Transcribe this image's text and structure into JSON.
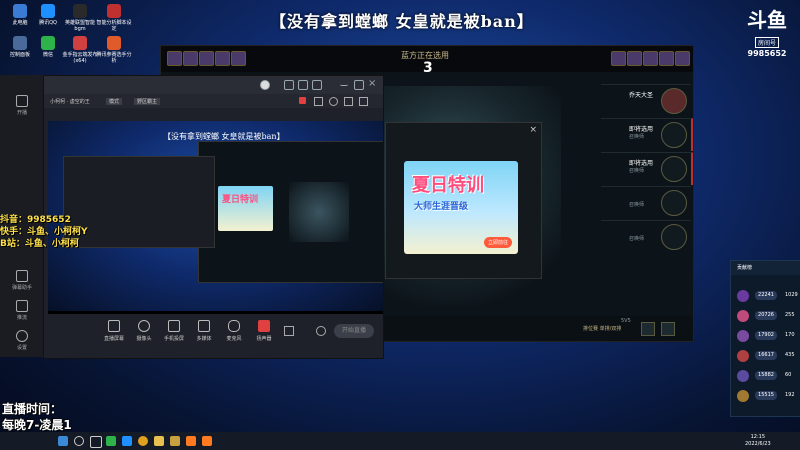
{
  "banner": "【没有拿到螳螂  女皇就是被ban】",
  "room": {
    "logo": "斗鱼",
    "label": "房间号",
    "number": "9985652"
  },
  "desktop_icons": [
    {
      "label": "此电脑",
      "color": "#3a7bd5"
    },
    {
      "label": "腾讯QQ",
      "color": "#1e90ff"
    },
    {
      "label": "英雄联盟智能bgm",
      "color": "#2a2a2a"
    },
    {
      "label": "智能分析脚本设定",
      "color": "#c03030"
    },
    {
      "label": "控制面板",
      "color": "#4a6a9a"
    },
    {
      "label": "微信",
      "color": "#2db34a"
    },
    {
      "label": "金手指云端发布(x64)",
      "color": "#d04040"
    },
    {
      "label": "腾讯参赛选手分析",
      "color": "#e05a2a"
    }
  ],
  "game": {
    "phase": "蓝方正在选用",
    "timer": "3",
    "slots": [
      {
        "name": "乔天大圣",
        "sub": ""
      },
      {
        "name": "即将选用",
        "sub": "召唤师"
      },
      {
        "name": "即将选用",
        "sub": "召唤师"
      },
      {
        "name": "",
        "sub": "召唤师"
      },
      {
        "name": "",
        "sub": "召唤师"
      }
    ],
    "bottom": {
      "rank_text": "排位赛 单排/双排",
      "slot_label": "5V5"
    }
  },
  "promo": {
    "title": "夏日特训",
    "subtitle": "大师生涯晋级",
    "button": "立即前往",
    "close": "×"
  },
  "streamer": {
    "toolbar": {
      "game_label": "小柯柯 · 虚空的王",
      "mode": "模式",
      "hero": "野区霸主"
    },
    "inner_banner": "【没有拿到螳螂 女皇就是被ban】",
    "mini_promo_title": "夏日特训",
    "controls": [
      "直播屏幕",
      "摄像头",
      "手机投屏",
      "多媒体",
      "麦克风",
      "扬声器"
    ],
    "go_live": "开始直播"
  },
  "sidepanel": [
    {
      "label": "开播"
    },
    {
      "label": "弹幕助手"
    },
    {
      "label": "推流"
    },
    {
      "label": "设置"
    }
  ],
  "overlay": {
    "douyin": "抖音：9985652",
    "kuaishou": "快手：斗鱼、小柯柯Y",
    "bilibili": "B站：斗鱼、小柯柯"
  },
  "live_time": {
    "label": "直播时间：",
    "value": "每晚7-凌晨1"
  },
  "ranking": {
    "header": "贡献榜",
    "rows": [
      {
        "v": "22241",
        "n": "1029"
      },
      {
        "v": "20726",
        "n": "255"
      },
      {
        "v": "17902",
        "n": "170"
      },
      {
        "v": "16617",
        "n": "435"
      },
      {
        "v": "15882",
        "n": "60"
      },
      {
        "v": "15515",
        "n": "192"
      }
    ]
  },
  "taskbar": {
    "time": "12:15",
    "date": "2022/6/23"
  }
}
